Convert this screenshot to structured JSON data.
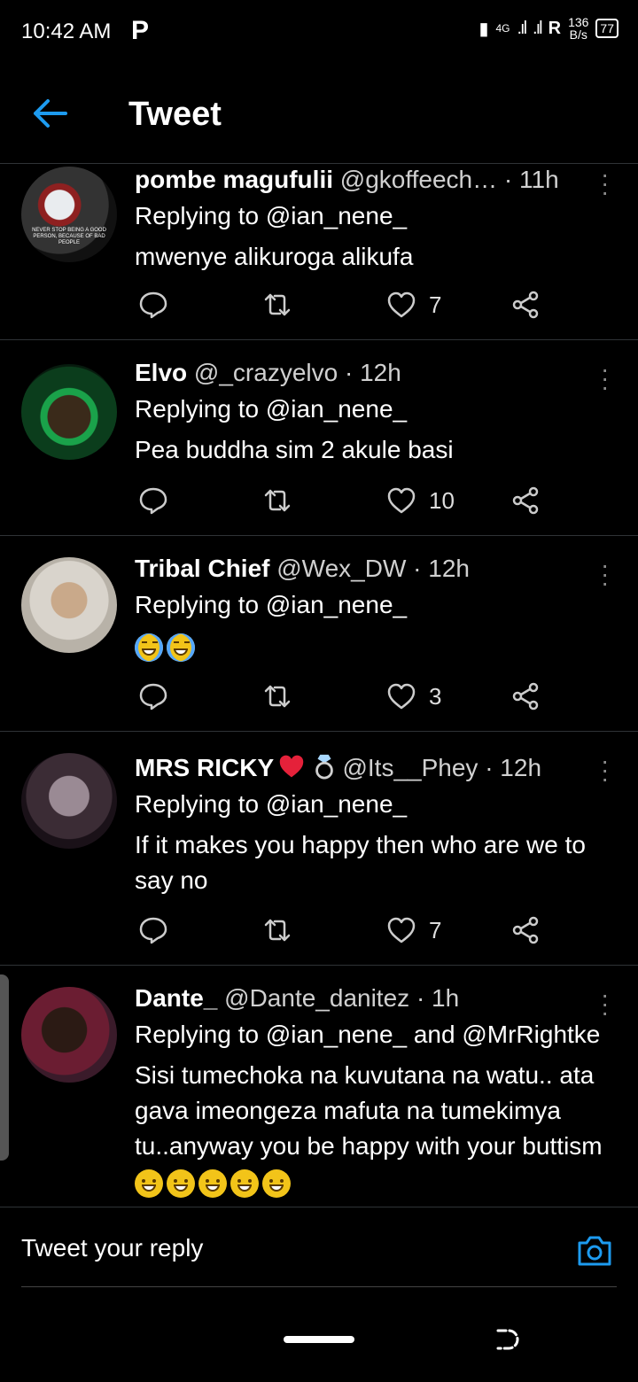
{
  "status_bar": {
    "time": "10:42 AM",
    "app_indicator": "P",
    "network": "4G",
    "roaming": "R",
    "speed_value": "136",
    "speed_unit": "B/s",
    "battery": "77"
  },
  "header": {
    "title": "Tweet",
    "back_icon": "arrow-left-icon"
  },
  "colors": {
    "accent": "#1d9bf0",
    "divider": "#2f3336",
    "background": "#000000"
  },
  "tweets": [
    {
      "name": "pombe magufulii",
      "handle": "@gkoffeech…",
      "time": "· 11h",
      "replying": "Replying to @ian_nene_",
      "body": "mwenye alikuroga alikufa",
      "likes": "7",
      "avatar_text": "NEVER STOP BEING A GOOD PERSON, BECAUSE OF BAD PEOPLE"
    },
    {
      "name": "Elvo",
      "handle": "@_crazyelvo",
      "time": "· 12h",
      "replying": "Replying to @ian_nene_",
      "body": "Pea buddha sim 2 akule basi",
      "likes": "10"
    },
    {
      "name": "Tribal Chief",
      "handle": "@Wex_DW",
      "time": "· 12h",
      "replying": "Replying to @ian_nene_",
      "body": "",
      "likes": "3"
    },
    {
      "name": "MRS RICKY",
      "handle": "@Its__Phey",
      "time": "· 12h",
      "replying": "Replying to @ian_nene_",
      "body": "If it makes you happy then who are we to say no",
      "likes": "7"
    },
    {
      "name": "Dante_",
      "handle": "@Dante_danitez",
      "time": "· 1h",
      "replying": "Replying to @ian_nene_ and @MrRightke",
      "body": "Sisi tumechoka na kuvutana na watu.. ata gava imeongeza mafuta na tumekimya tu..anyway you be happy with your buttism"
    }
  ],
  "reply_bar": {
    "placeholder": "Tweet your reply"
  }
}
